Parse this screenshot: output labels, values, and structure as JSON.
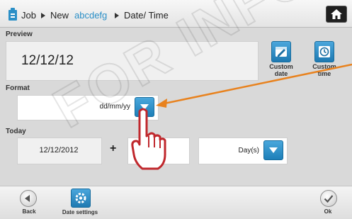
{
  "breadcrumb": {
    "item1": "Job",
    "item2": "New",
    "job_name": "abcdefg",
    "item4": "Date/ Time"
  },
  "preview": {
    "label": "Preview",
    "value": "12/12/12",
    "custom_date_label": "Custom date",
    "custom_time_label": "Custom time"
  },
  "format": {
    "label": "Format",
    "value": "dd/mm/yy"
  },
  "today": {
    "label": "Today",
    "date": "12/12/2012",
    "plus": "+",
    "offset_value": "",
    "unit": "Day(s)"
  },
  "bottom": {
    "back_label": "Back",
    "date_settings_label": "Date settings",
    "ok_label": "Ok"
  },
  "watermark": "FOR INFO",
  "colors": {
    "accent_blue": "#2a8fc7",
    "annotation_orange": "#e8821e",
    "hand_red": "#c0282d"
  }
}
